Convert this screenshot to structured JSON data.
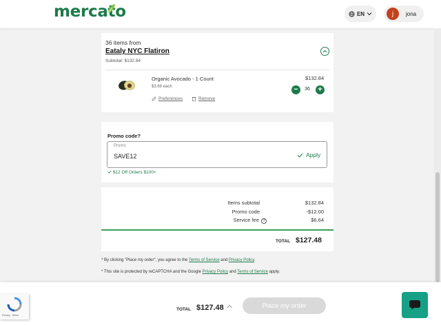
{
  "header": {
    "logo": "mercato",
    "language": "EN",
    "user_initial": "j",
    "user_name": "jona"
  },
  "store": {
    "items_from": "36 items from",
    "name": "Eataly NYC Flatiron",
    "subtotal": "Subtotal: $132.84"
  },
  "product": {
    "name": "Organic Avocado - 1 Count",
    "unit_price": "$3.69 each",
    "price": "$132.84",
    "quantity": "36",
    "preferences": "Preferences",
    "remove": "Remove"
  },
  "promo": {
    "title": "Promo code?",
    "field_label": "Promo",
    "code": "SAVE12",
    "apply": "Apply",
    "applied": "$12 Off Orders $100+"
  },
  "totals": {
    "items_subtotal_label": "Items subtotal",
    "items_subtotal": "$132.84",
    "promo_label": "Promo code",
    "promo": "-$12.00",
    "service_fee_label": "Service fee",
    "service_fee": "$6.64",
    "total_label": "TOTAL",
    "total": "$127.48"
  },
  "notes": {
    "n1_a": "* By clicking \"Place my order\", you agree to the ",
    "n1_link1": "Terms of Service",
    "n1_b": " and ",
    "n1_link2": "Privacy Policy",
    "n1_c": ".",
    "n2_a": "* This site is protected by reCAPTCHA and the Google ",
    "n2_link1": "Privacy Policy",
    "n2_b": " and ",
    "n2_link2": "Terms of Service",
    "n2_c": " apply."
  },
  "footer": {
    "total_label": "TOTAL",
    "total": "$127.48",
    "place_order": "Place my order",
    "recaptcha_text": "Privacy - Terms"
  },
  "colors": {
    "brand_green": "#1d7a4a",
    "accent_bar": "#36a05a",
    "chat_teal": "#16a085",
    "avatar": "#c2411c"
  }
}
